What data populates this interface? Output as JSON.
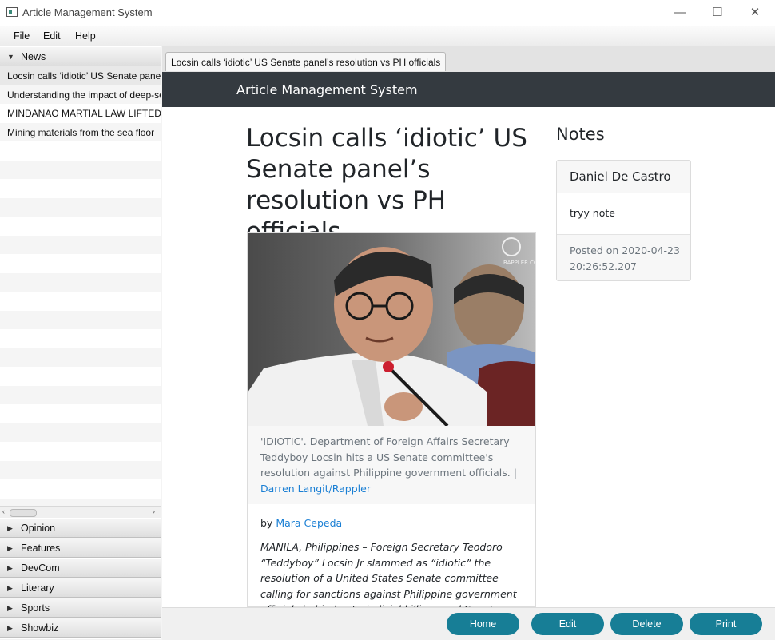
{
  "window": {
    "title": "Article Management System",
    "min_glyph": "—",
    "max_glyph": "☐",
    "close_glyph": "✕"
  },
  "menubar": [
    "File",
    "Edit",
    "Help"
  ],
  "sidebar": {
    "news_label": "News",
    "news_items": [
      "Locsin calls ‘idiotic’ US Senate panel’s resolution vs PH officials",
      "Understanding the impact of deep-sea mining",
      "MINDANAO MARTIAL LAW LIFTED SOON",
      "Mining materials from the sea floor"
    ],
    "sections": [
      "Opinion",
      "Features",
      "DevCom",
      "Literary",
      "Sports",
      "Showbiz"
    ]
  },
  "tab": {
    "label": "Locsin calls ‘idiotic’ US Senate panel’s resolution vs PH officials"
  },
  "page": {
    "brand": "Article Management System",
    "title": "Locsin calls ‘idiotic’ US Senate panel’s resolution vs PH officials",
    "caption": "'IDIOTIC'. Department of Foreign Affairs Secretary Teddyboy Locsin hits a US Senate committee's resolution against Philippine government officials. |",
    "caption_credit": "Darren Langit/Rappler",
    "photo_watermark": "RAPPLER.COM",
    "byline_prefix": "by",
    "author": "Mara Cepeda",
    "body": "MANILA, Philippines – Foreign Secretary Teodoro “Teddyboy” Locsin Jr slammed as “idiotic” the resolution of a United States Senate committee calling for sanctions against Philippine government officials behind extrajudicial killings and Senator Leila de Lima's detention"
  },
  "notes": {
    "heading": "Notes",
    "author": "Daniel De Castro",
    "text": "tryy note",
    "posted": "Posted on 2020-04-23 20:26:52.207"
  },
  "buttons": {
    "home": "Home",
    "edit": "Edit",
    "delete": "Delete",
    "print": "Print"
  },
  "colors": {
    "navbar": "#343a40",
    "button": "#177e96",
    "link": "#1a7fd4"
  }
}
